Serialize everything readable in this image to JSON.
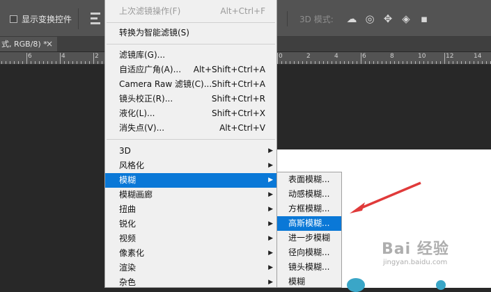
{
  "options_bar": {
    "show_transform_controls_label": "显示变换控件",
    "mode_3d_label": "3D 模式:"
  },
  "doc_tab": {
    "title": "式, RGB/8) *",
    "close_glyph": "×"
  },
  "rulers": {
    "left_labels": [
      "6",
      "4",
      "2"
    ],
    "right_labels": [
      "0",
      "2",
      "4",
      "6",
      "8",
      "10",
      "12",
      "14"
    ]
  },
  "filter_menu": {
    "last_filter": {
      "label": "上次滤镜操作(F)",
      "shortcut": "Alt+Ctrl+F"
    },
    "convert_smart": {
      "label": "转换为智能滤镜(S)"
    },
    "filter_gallery": {
      "label": "滤镜库(G)..."
    },
    "adaptive_wide": {
      "label": "自适应广角(A)...",
      "shortcut": "Alt+Shift+Ctrl+A"
    },
    "camera_raw": {
      "label": "Camera Raw 滤镜(C)...",
      "shortcut": "Shift+Ctrl+A"
    },
    "lens_correction": {
      "label": "镜头校正(R)...",
      "shortcut": "Shift+Ctrl+R"
    },
    "liquify": {
      "label": "液化(L)...",
      "shortcut": "Shift+Ctrl+X"
    },
    "vanishing_point": {
      "label": "消失点(V)...",
      "shortcut": "Alt+Ctrl+V"
    },
    "submenus": [
      "3D",
      "风格化",
      "模糊",
      "模糊画廊",
      "扭曲",
      "锐化",
      "视频",
      "像素化",
      "渲染",
      "杂色"
    ],
    "highlighted": "模糊"
  },
  "blur_submenu": {
    "items": [
      "表面模糊...",
      "动感模糊...",
      "方框模糊...",
      "高斯模糊...",
      "进一步模糊",
      "径向模糊...",
      "镜头模糊...",
      "模糊"
    ],
    "highlighted": "高斯模糊..."
  },
  "watermark": {
    "text": "Bai 经验",
    "url": "jingyan.baidu.com"
  },
  "colors": {
    "highlight": "#0a78d7",
    "menu_bg": "#f0f0f0",
    "arrow": "#e03a3a"
  }
}
